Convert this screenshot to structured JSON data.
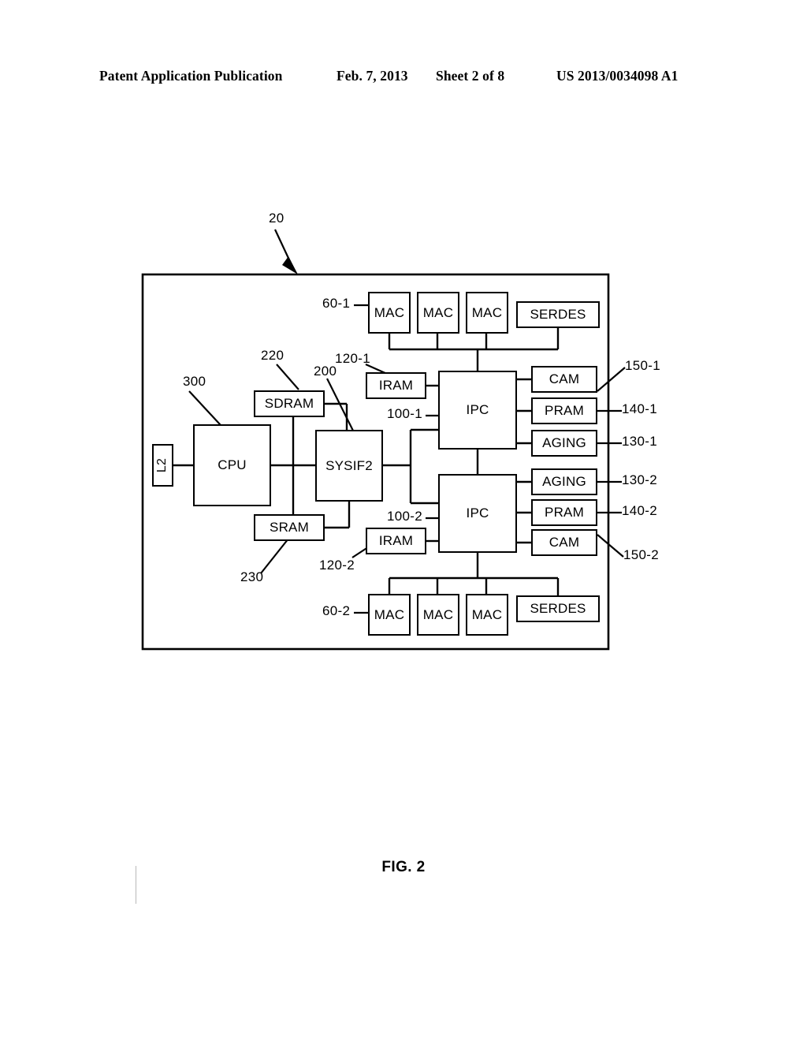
{
  "header": {
    "publication": "Patent Application Publication",
    "date": "Feb. 7, 2013",
    "sheet": "Sheet 2 of 8",
    "patent_number": "US 2013/0034098 A1"
  },
  "figure": {
    "caption": "FIG. 2",
    "chip_reference": "20"
  },
  "blocks": {
    "l2": "L2",
    "cpu": "CPU",
    "sdram": "SDRAM",
    "sram": "SRAM",
    "sysif2": "SYSIF2",
    "iram_1": "IRAM",
    "iram_2": "IRAM",
    "ipc_1": "IPC",
    "ipc_2": "IPC",
    "mac_top_1": "MAC",
    "mac_top_2": "MAC",
    "mac_top_3": "MAC",
    "serdes_top": "SERDES",
    "mac_bottom_1": "MAC",
    "mac_bottom_2": "MAC",
    "mac_bottom_3": "MAC",
    "serdes_bottom": "SERDES",
    "cam_1": "CAM",
    "pram_1": "PRAM",
    "aging_1": "AGING",
    "aging_2": "AGING",
    "pram_2": "PRAM",
    "cam_2": "CAM"
  },
  "reference_labels": {
    "chip": "20",
    "mac_group_top": "60-1",
    "mac_group_bottom": "60-2",
    "ipc_top": "100-1",
    "ipc_bottom": "100-2",
    "iram_top": "120-1",
    "iram_bottom": "120-2",
    "aging_top": "130-1",
    "aging_bottom": "130-2",
    "pram_top": "140-1",
    "pram_bottom": "140-2",
    "cam_top": "150-1",
    "cam_bottom": "150-2",
    "sysif2": "200",
    "sdram": "220",
    "sram": "230",
    "cpu": "300"
  },
  "colors": {
    "line": "#000000",
    "background": "#ffffff"
  }
}
